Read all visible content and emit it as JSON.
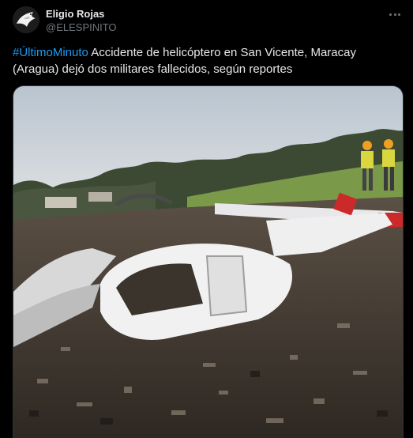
{
  "author": {
    "display_name": "Eligio Rojas",
    "handle": "@ELESPINITO",
    "avatar_icon": "eagle-avatar-icon"
  },
  "menu": {
    "icon": "more-horizontal-icon"
  },
  "post": {
    "hashtag": "#ÚltimoMinuto",
    "text": " Accidente de helicóptero en San Vicente, Maracay (Aragua) dejó dos militares fallecidos, según reportes"
  },
  "media": {
    "type": "photo",
    "subject": "crashed-helicopter-wreckage"
  },
  "colors": {
    "background": "#000000",
    "text": "#e7e9ea",
    "secondary": "#71767b",
    "link": "#1d9bf0",
    "border": "#2f3336"
  }
}
